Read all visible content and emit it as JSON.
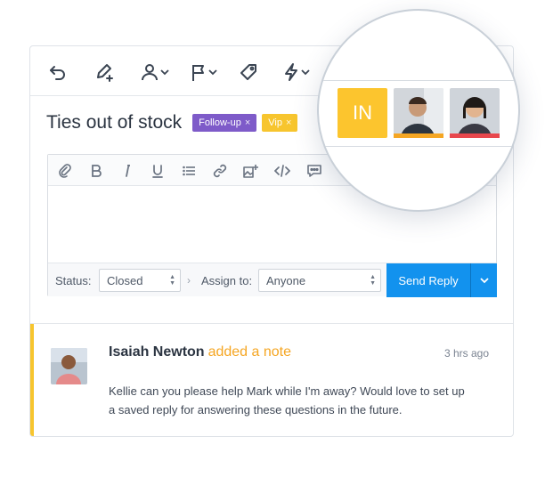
{
  "conversation": {
    "subject": "Ties out of stock",
    "tags": [
      {
        "label": "Follow-up",
        "remove": "×",
        "color": "#7e5bc9"
      },
      {
        "label": "Vip",
        "remove": "×",
        "color": "#f7c52e"
      }
    ]
  },
  "toolbar": {
    "icons": [
      "undo-icon",
      "pen-plus-icon",
      "user-icon",
      "flag-icon",
      "tag-icon",
      "lightning-icon"
    ]
  },
  "editor": {
    "toolbar_icons": [
      "paperclip-icon",
      "bold-icon",
      "italic-icon",
      "underline-icon",
      "list-icon",
      "link-icon",
      "image-icon",
      "code-icon",
      "chat-icon"
    ],
    "status_label": "Status:",
    "status_value": "Closed",
    "assign_label": "Assign to:",
    "assign_value": "Anyone",
    "send_label": "Send Reply"
  },
  "magnifier": {
    "initials": "IN",
    "initials_color": "#fcc52e",
    "avatar_underlines": [
      "#fcc52e",
      "#f5a623",
      "#e8474d"
    ]
  },
  "note": {
    "author": "Isaiah Newton",
    "action": "added a note",
    "time": "3 hrs ago",
    "text": "Kellie can you please help Mark while I'm away? Would love to set up a saved reply for answering these questions in the future.",
    "accent_color": "#f7c52e"
  }
}
